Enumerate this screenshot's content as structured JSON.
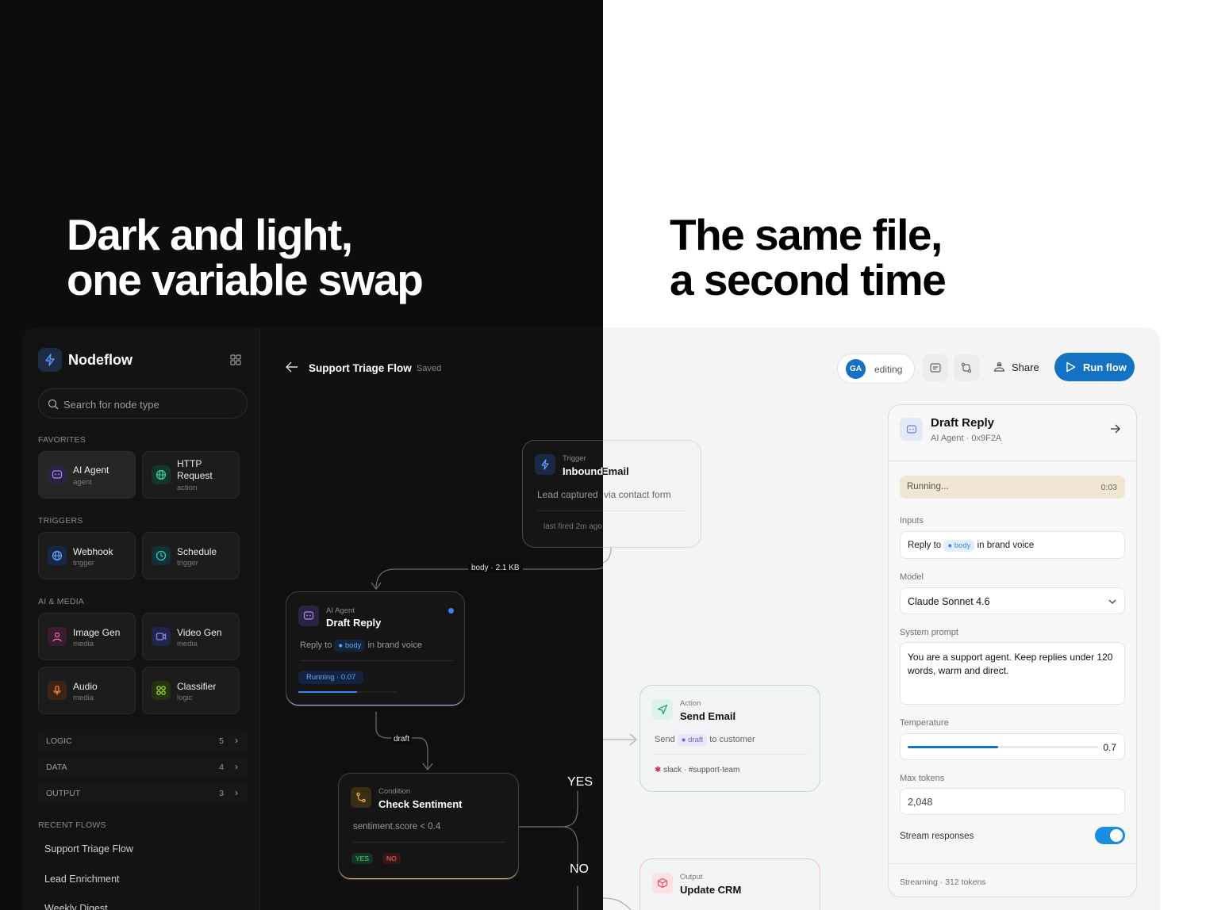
{
  "headline_left": {
    "line1": "Dark and light,",
    "line2": "one variable swap"
  },
  "headline_right": {
    "line1": "The same file,",
    "line2": "a second time"
  },
  "app": {
    "name": "Nodeflow"
  },
  "search": {
    "placeholder": "Search for node type"
  },
  "favorites": {
    "label": "FAVORITES",
    "items": [
      {
        "title": "AI Agent",
        "sub": "agent"
      },
      {
        "title": "HTTP",
        "title2": "Request",
        "sub": "action"
      }
    ]
  },
  "triggers": {
    "label": "TRIGGERS",
    "items": [
      {
        "title": "Webhook",
        "sub": "trigger"
      },
      {
        "title": "Schedule",
        "sub": "trigger"
      }
    ]
  },
  "ai_media": {
    "label": "AI & MEDIA",
    "items": [
      {
        "title": "Image Gen",
        "sub": "media"
      },
      {
        "title": "Video Gen",
        "sub": "media"
      },
      {
        "title": "Audio",
        "sub": "media"
      },
      {
        "title": "Classifier",
        "sub": "logic"
      }
    ]
  },
  "categories": [
    {
      "name": "LOGIC",
      "count": "5"
    },
    {
      "name": "DATA",
      "count": "4"
    },
    {
      "name": "OUTPUT",
      "count": "3"
    }
  ],
  "recent": {
    "label": "RECENT FLOWS",
    "items": [
      "Support Triage Flow",
      "Lead Enrichment",
      "Weekly Digest"
    ]
  },
  "flow": {
    "title": "Support Triage Flow",
    "status": "Saved"
  },
  "toolbar": {
    "avatar": "GA",
    "presence": "editing",
    "share": "Share",
    "run": "Run flow"
  },
  "nodes": {
    "trigger": {
      "kind": "Trigger",
      "title_a": "Inbound",
      "title_b": "Email",
      "desc_a": "Lead captured",
      "desc_b": "via contact form",
      "foot": "last fired 2m ago"
    },
    "edge_body": "body · 2.1 KB",
    "agent": {
      "kind": "AI Agent",
      "title": "Draft Reply",
      "pre": "Reply to",
      "chip": "body",
      "post": "in brand voice",
      "status": "Running · 0.07",
      "progress": 0.6
    },
    "edge_draft": "draft",
    "condition": {
      "kind": "Condition",
      "title": "Check Sentiment",
      "expr": "sentiment.score < 0.4",
      "yes": "YES",
      "no": "NO"
    },
    "branch_yes": "YES",
    "branch_no": "NO",
    "action": {
      "kind": "Action",
      "title": "Send Email",
      "pre": "Send",
      "chip": "draft",
      "post": "to customer",
      "foot": "slack · #support-team"
    },
    "output": {
      "kind": "Output",
      "title": "Update CRM"
    }
  },
  "panel": {
    "title": "Draft Reply",
    "sub": "AI Agent · 0x9F2A",
    "status": "Running...",
    "time": "0:03",
    "inputs_label": "Inputs",
    "input_pre": "Reply to",
    "input_chip": "body",
    "input_post": "in brand voice",
    "model_label": "Model",
    "model": "Claude Sonnet 4.6",
    "prompt_label": "System prompt",
    "prompt": "You are a support agent. Keep replies under 120 words, warm and direct.",
    "temp_label": "Temperature",
    "temperature": "0.7",
    "max_label": "Max tokens",
    "max_tokens": "2,048",
    "stream_label": "Stream responses",
    "stream_on": true,
    "footer": "Streaming · 312 tokens"
  },
  "colors": {
    "accent": "#1472c4",
    "dark_bg": "#0d0d0d",
    "chip_blue": "#3b82f6",
    "running_bg": "#f1e6d3"
  }
}
